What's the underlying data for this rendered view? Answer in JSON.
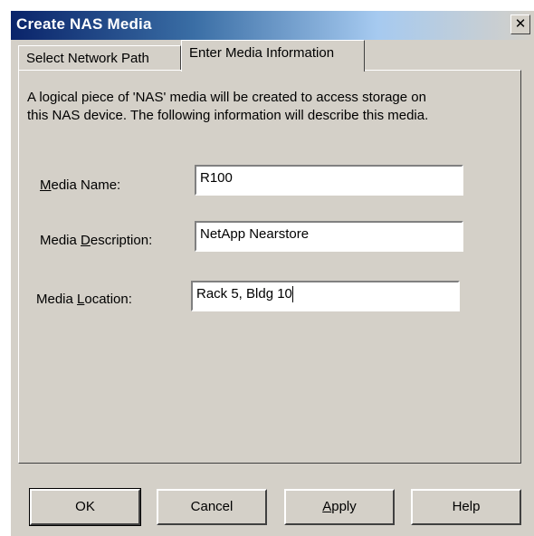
{
  "window": {
    "title": "Create NAS Media",
    "close_glyph": "✕"
  },
  "tabs": [
    {
      "label": "Select Network Path",
      "active": false
    },
    {
      "label": "Enter Media Information",
      "active": true
    }
  ],
  "info": {
    "line1": "A logical piece of 'NAS' media will be created to access storage on",
    "line2": "this NAS device.  The following information will describe this media."
  },
  "fields": {
    "name": {
      "label_pre": "",
      "label_u": "M",
      "label_post": "edia Name:",
      "value": "R100"
    },
    "description": {
      "label_pre": "Media ",
      "label_u": "D",
      "label_post": "escription:",
      "value": "NetApp Nearstore"
    },
    "location": {
      "label_pre": "Media ",
      "label_u": "L",
      "label_post": "ocation:",
      "value": "Rack 5, Bldg 10"
    }
  },
  "buttons": {
    "ok": "OK",
    "cancel": "Cancel",
    "apply_u": "A",
    "apply_rest": "pply",
    "help": "Help"
  }
}
